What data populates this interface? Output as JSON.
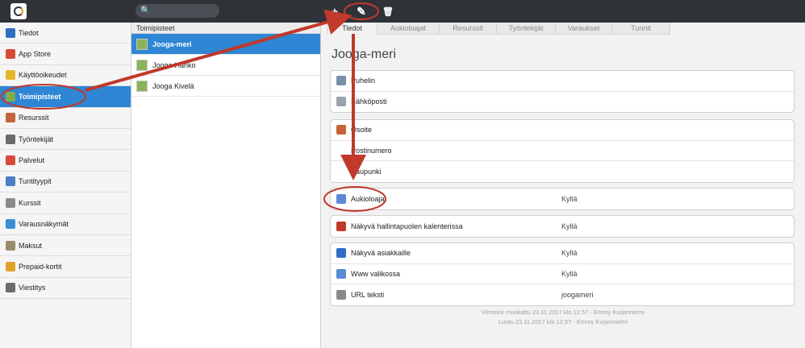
{
  "toolbar": {
    "add_icon": "plus-icon",
    "edit_icon": "pencil-icon",
    "delete_icon": "trash-icon",
    "add_glyph": "+",
    "edit_glyph": "✎",
    "delete_glyph": "🗑"
  },
  "search": {
    "icon": "search-icon",
    "glyph": "🔍",
    "placeholder": ""
  },
  "sidebar": {
    "items": [
      {
        "label": "Tiedot",
        "icon": "info-icon",
        "color": "#2e6fc4"
      },
      {
        "label": "App Store",
        "icon": "app-store-icon",
        "color": "#d64b3a"
      },
      {
        "label": "Käyttöoikeudet",
        "icon": "star-icon",
        "color": "#e7b62a"
      },
      {
        "label": "Toimipisteet",
        "icon": "location-icon",
        "color": "#7fae4f",
        "active": true
      },
      {
        "label": "Resurssit",
        "icon": "house-icon",
        "color": "#c4643a"
      },
      {
        "label": "Työntekijät",
        "icon": "person-icon",
        "color": "#6b6b6b"
      },
      {
        "label": "Palvelut",
        "icon": "calendar-icon",
        "color": "#d64b3a"
      },
      {
        "label": "Tuntityypit",
        "icon": "calendar-grid-icon",
        "color": "#4a7fc4"
      },
      {
        "label": "Kurssit",
        "icon": "course-icon",
        "color": "#8a8a8a"
      },
      {
        "label": "Varausnäkymät",
        "icon": "globe-icon",
        "color": "#3a8fd6"
      },
      {
        "label": "Maksut",
        "icon": "payment-icon",
        "color": "#9a8a6a"
      },
      {
        "label": "Prepaid-kortit",
        "icon": "card-icon",
        "color": "#e0a22a"
      },
      {
        "label": "Viestitys",
        "icon": "message-icon",
        "color": "#6b6b6b"
      }
    ]
  },
  "list": {
    "header": "Toimipisteet",
    "items": [
      {
        "label": "Jooga-meri",
        "active": true
      },
      {
        "label": "Jooga-Hanko"
      },
      {
        "label": "Jooga Kivelä"
      }
    ]
  },
  "detail": {
    "title": "Jooga-meri",
    "tabs": [
      {
        "label": "Tiedot",
        "active": true
      },
      {
        "label": "Aukioloajat"
      },
      {
        "label": "Resurssit"
      },
      {
        "label": "Työntekijät"
      },
      {
        "label": "Varaukset"
      },
      {
        "label": "Tunnit"
      }
    ],
    "groups": [
      {
        "rows": [
          {
            "label": "Puhelin",
            "value": "",
            "icon": "phone-icon"
          },
          {
            "label": "Sähköposti",
            "value": "",
            "icon": "email-icon"
          }
        ]
      },
      {
        "rows": [
          {
            "label": "Osoite",
            "value": "",
            "icon": "home-icon"
          },
          {
            "label": "Postinumero",
            "value": "",
            "icon": ""
          },
          {
            "label": "Kaupunki",
            "value": "",
            "icon": ""
          }
        ]
      },
      {
        "rows": [
          {
            "label": "Aukioloajat",
            "value": "Kyllä",
            "icon": "clock-icon"
          }
        ]
      },
      {
        "rows": [
          {
            "label": "Näkyvä hallintapuolen kalenterissa",
            "value": "Kyllä",
            "icon": "visible-icon"
          }
        ]
      },
      {
        "rows": [
          {
            "label": "Näkyvä asiakkaille",
            "value": "Kyllä",
            "icon": "visible-public-icon"
          },
          {
            "label": "Www valikossa",
            "value": "Kyllä",
            "icon": "web-menu-icon"
          },
          {
            "label": "URL teksti",
            "value": "joogameri",
            "icon": "url-icon"
          }
        ]
      }
    ],
    "footer": {
      "modified": "Viimeksi muokattu 23.11.2017 klo 12.57 - Emmy Kurjenniemi",
      "created": "Luotu 23.11.2017 klo 12.57 - Emmy Kurjenniemi"
    }
  },
  "colors": {
    "topbar": "#2f3338",
    "accent": "#2e86d4",
    "annotation": "#c0392b"
  }
}
